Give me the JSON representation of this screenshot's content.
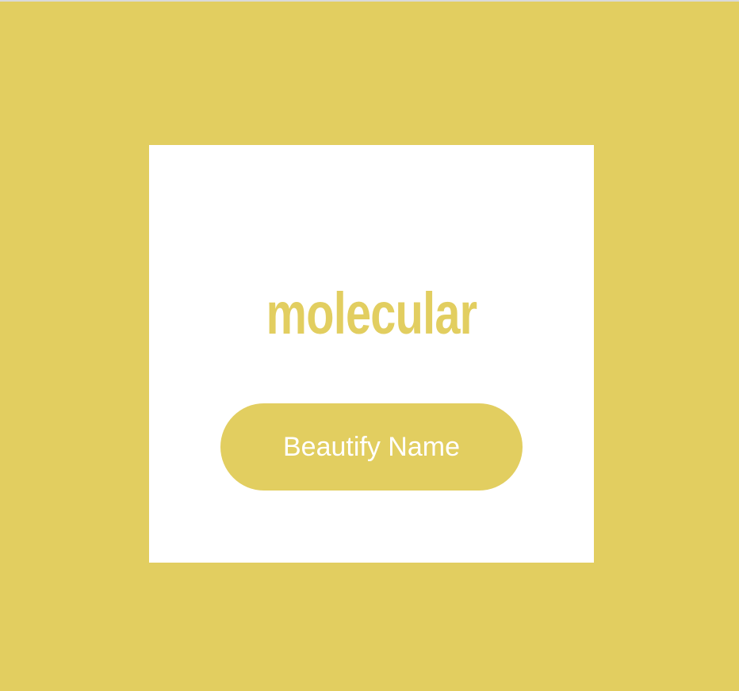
{
  "colors": {
    "background": "#e2ce60",
    "card": "#ffffff",
    "accent": "#e2ce60",
    "button_text": "#ffffff"
  },
  "card": {
    "name_text": "molecular",
    "button_label": "Beautify Name"
  }
}
